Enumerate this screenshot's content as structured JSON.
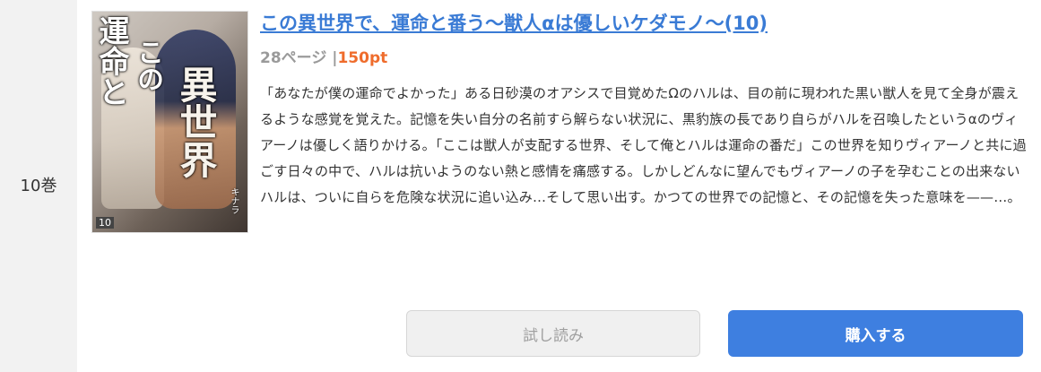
{
  "volume": {
    "label": "10巻"
  },
  "cover": {
    "title_part1": "運命と",
    "title_part2": "異世界",
    "title_part3": "この",
    "volume_number": "10",
    "author": "キナラ"
  },
  "book": {
    "title": "この異世界で、運命と番う〜獣人αは優しいケダモノ〜(10)",
    "pages": "28ページ",
    "separator": "|",
    "price": "150pt",
    "description": "「あなたが僕の運命でよかった」ある日砂漠のオアシスで目覚めたΩのハルは、目の前に現われた黒い獣人を見て全身が震えるような感覚を覚えた。記憶を失い自分の名前すら解らない状況に、黒豹族の長であり自らがハルを召喚したというαのヴィアーノは優しく語りかける。「ここは獣人が支配する世界、そして俺とハルは運命の番だ」この世界を知りヴィアーノと共に過ごす日々の中で、ハルは抗いようのない熱と感情を痛感する。しかしどんなに望んでもヴィアーノの子を孕むことの出来ないハルは、ついに自らを危険な状況に追い込み…そして思い出す。かつての世界での記憶と、その記憶を失った意味を——…。"
  },
  "buttons": {
    "trial_label": "試し読み",
    "buy_label": "購入する"
  },
  "colors": {
    "title_link": "#3a7bd5",
    "price": "#ef6c2c",
    "buy_button": "#3e7fe0",
    "trial_button": "#f0f0f0",
    "sidebar": "#f2f2f2"
  }
}
